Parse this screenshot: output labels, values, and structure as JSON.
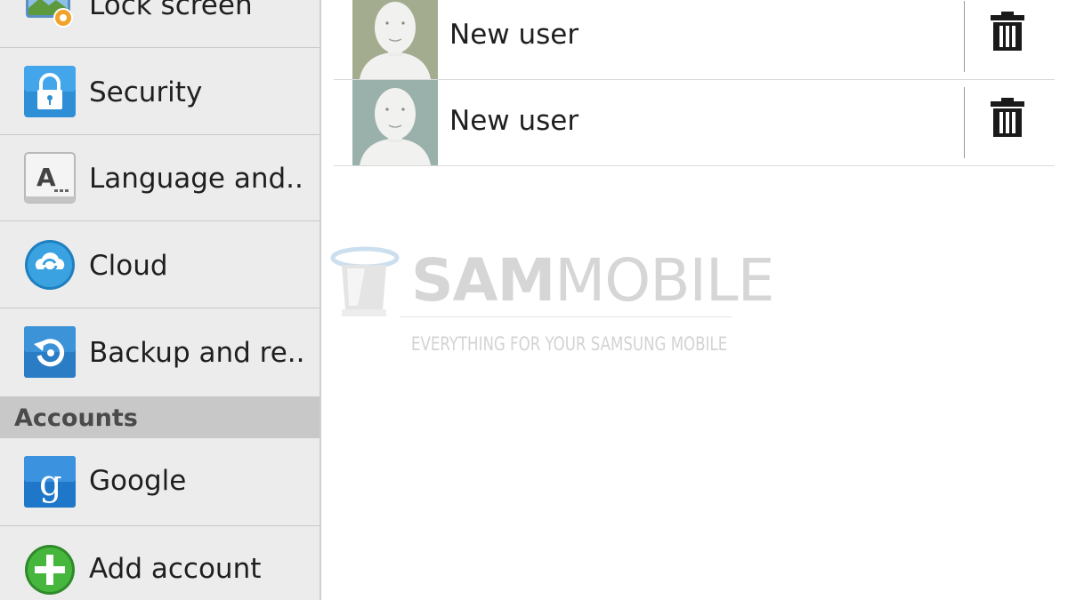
{
  "sidebar": {
    "items": [
      {
        "label": "Lock screen",
        "icon": "lock-screen-icon"
      },
      {
        "label": "Security",
        "icon": "security-lock-icon"
      },
      {
        "label": "Language and..",
        "icon": "language-keyboard-icon"
      },
      {
        "label": "Cloud",
        "icon": "cloud-icon"
      },
      {
        "label": "Backup and re..",
        "icon": "backup-restore-icon"
      }
    ],
    "section_header": "Accounts",
    "account_items": [
      {
        "label": "Google",
        "icon": "google-icon"
      },
      {
        "label": "Add account",
        "icon": "add-icon"
      }
    ]
  },
  "users": [
    {
      "name": "New user",
      "avatar_bg": "#a3ac8e",
      "action_icon": "trash-icon"
    },
    {
      "name": "New user",
      "avatar_bg": "#9ab0ab",
      "action_icon": "trash-icon"
    }
  ],
  "watermark": {
    "brand_bold": "SAM",
    "brand_light": "MOBILE",
    "tagline": "EVERYTHING FOR YOUR SAMSUNG MOBILE"
  },
  "colors": {
    "sidebar_bg": "#ececec",
    "section_header_bg": "#c8c8c8",
    "accent_blue": "#2e8fd6",
    "add_green": "#3aa832"
  }
}
